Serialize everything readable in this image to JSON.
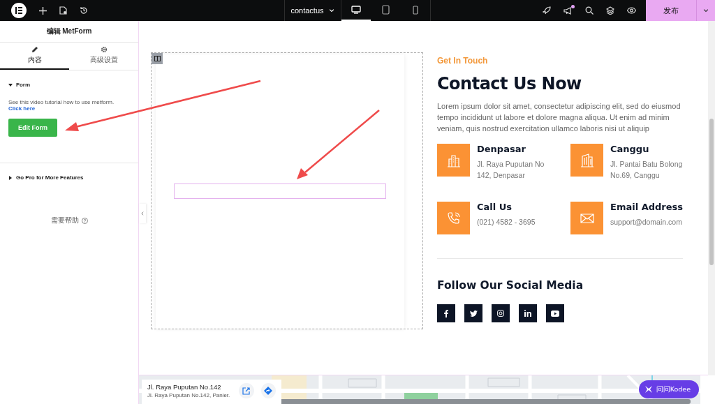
{
  "topbar": {
    "page_name": "contactus",
    "notification": true,
    "publish": "发布",
    "devices": [
      {
        "kind": "desktop",
        "selected": true
      },
      {
        "kind": "tablet",
        "selected": false
      },
      {
        "kind": "mobile",
        "selected": false
      }
    ]
  },
  "panel": {
    "title": "编辑 MetForm",
    "tabs": [
      {
        "kind": "content",
        "label": "内容",
        "selected": true
      },
      {
        "kind": "advanced",
        "label": "高级设置",
        "selected": false
      }
    ],
    "sections": [
      {
        "title": "Form",
        "expanded": true,
        "description": "See this video tutorial how to use metform.",
        "link": "Click here",
        "button": "Edit Form"
      },
      {
        "title": "Go Pro for More Features",
        "expanded": false
      }
    ],
    "help": "需要帮助"
  },
  "contact": {
    "eyebrow": "Get In Touch",
    "heading": "Contact Us Now",
    "intro": "Lorem ipsum dolor sit amet, consectetur adipiscing elit, sed do eiusmod tempo incididunt ut labore et dolore magna aliqua. Ut enim ad minim veniam, quis nostrud exercitation ullamco laboris nisi ut aliquip",
    "items": [
      {
        "kind": "city",
        "title": "Denpasar",
        "lines": [
          "Jl. Raya Puputan No",
          "142, Denpasar"
        ]
      },
      {
        "kind": "building",
        "title": "Canggu",
        "lines": [
          "Jl. Pantai Batu Bolong",
          "No.69, Canggu"
        ]
      },
      {
        "kind": "phone",
        "title": "Call Us",
        "lines": [
          "(021) 4582 - 3695"
        ]
      },
      {
        "kind": "mail",
        "title": "Email Address",
        "lines": [
          "support@domain.com"
        ]
      }
    ],
    "social_heading": "Follow Our Social Media",
    "social": [
      {
        "kind": "facebook"
      },
      {
        "kind": "twitter"
      },
      {
        "kind": "instagram"
      },
      {
        "kind": "linkedin"
      },
      {
        "kind": "youtube"
      }
    ]
  },
  "map": {
    "card_title": "Jl. Raya Puputan No.142",
    "card_address": "Jl. Raya Puputan No.142, Panier."
  },
  "assistant": "问问Kodee"
}
